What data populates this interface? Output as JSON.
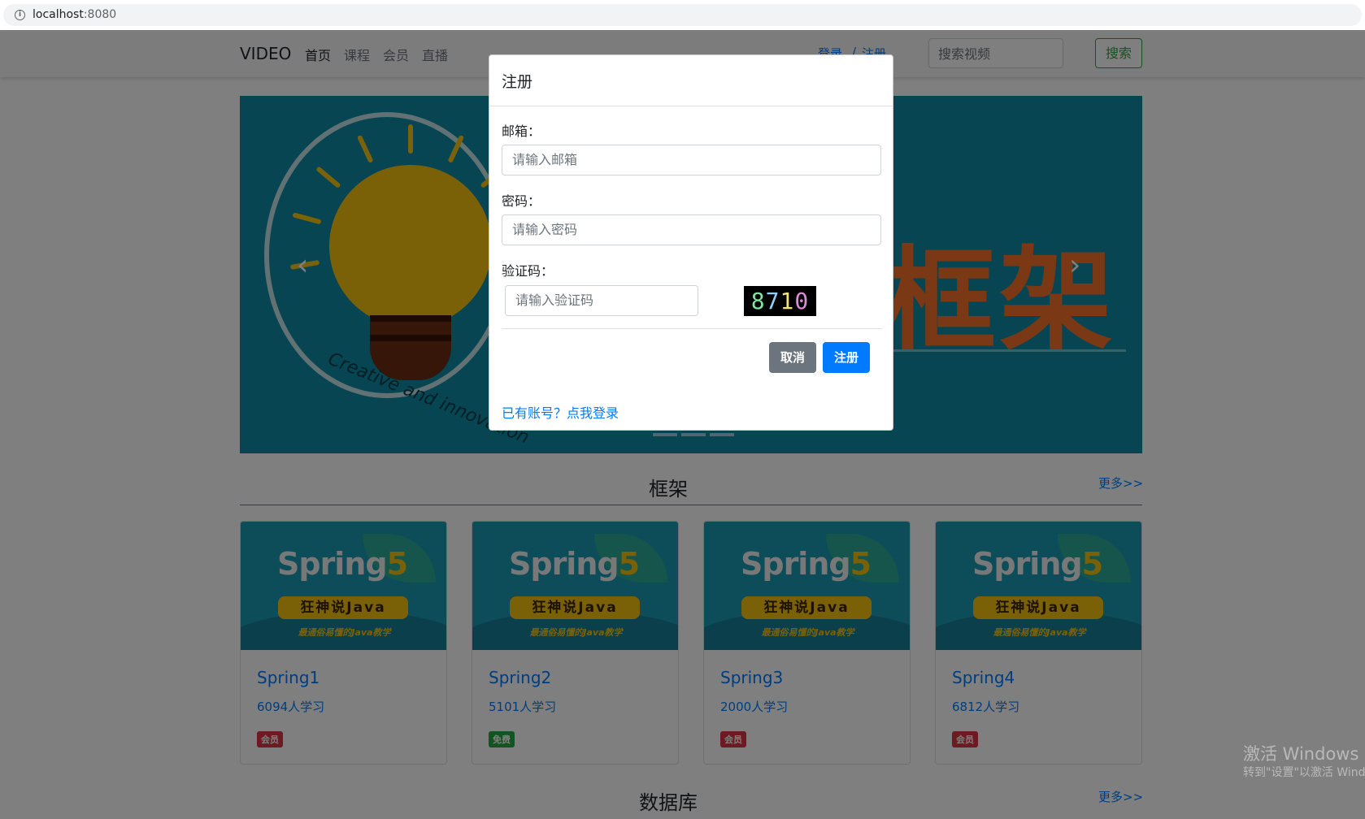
{
  "browser": {
    "url_host": "localhost",
    "url_port": ":8080"
  },
  "navbar": {
    "brand": "VIDEO",
    "links": [
      "首页",
      "课程",
      "会员",
      "直播"
    ],
    "login": "登录",
    "separator": "/",
    "register": "注册",
    "search_placeholder": "搜索视频",
    "search_button": "搜索"
  },
  "carousel": {
    "title": "框架",
    "arc_text": "Creative and innovation",
    "prev_icon": "chevron-left-icon",
    "next_icon": "chevron-right-icon"
  },
  "sections": [
    {
      "title": "框架",
      "more": "更多>>",
      "cards": [
        {
          "name": "Spring1",
          "students": "6094人学习",
          "badge": "会员",
          "badge_color": "#dc3545"
        },
        {
          "name": "Spring2",
          "students": "5101人学习",
          "badge": "免费",
          "badge_color": "#28a745"
        },
        {
          "name": "Spring3",
          "students": "2000人学习",
          "badge": "会员",
          "badge_color": "#dc3545"
        },
        {
          "name": "Spring4",
          "students": "6812人学习",
          "badge": "会员",
          "badge_color": "#dc3545"
        }
      ]
    },
    {
      "title": "数据库",
      "more": "更多>>"
    }
  ],
  "thumbnail": {
    "title_main": "Spring",
    "title_num": "5",
    "bar": "狂神说Java",
    "sub": "最通俗易懂的Java教学"
  },
  "modal": {
    "title": "注册",
    "email_label": "邮箱：",
    "email_placeholder": "请输入邮箱",
    "password_label": "密码：",
    "password_placeholder": "请输入密码",
    "captcha_label": "验证码：",
    "captcha_placeholder": "请输入验证码",
    "captcha_code": [
      "8",
      "7",
      "1",
      "0"
    ],
    "cancel": "取消",
    "submit": "注册",
    "login_link": "已有账号？点我登录"
  },
  "watermark": {
    "line1": "激活 Windows",
    "line2": "转到\"设置\"以激活 Windows。"
  },
  "colors": {
    "primary": "#007bff",
    "success": "#28a745",
    "secondary": "#6c757d",
    "danger": "#dc3545",
    "carousel_bg": "#0e8aa4",
    "accent_orange": "#f4712a"
  }
}
